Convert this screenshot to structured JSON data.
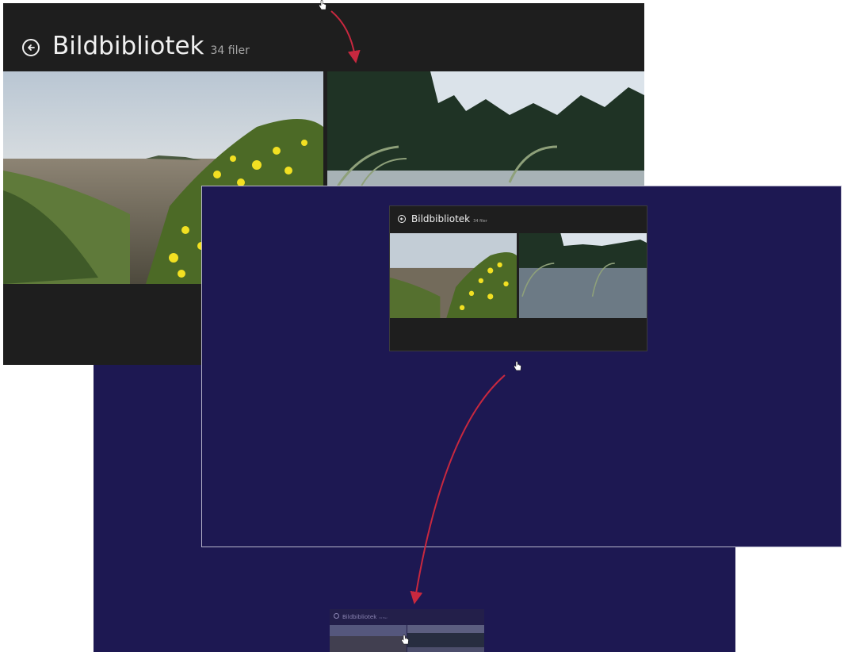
{
  "colors": {
    "start_screen": "#1d1852",
    "app_background": "#1e1e1e",
    "title_text": "#f0f0f0",
    "count_text": "#a8a8a8",
    "arrow": "#c8283f"
  },
  "app": {
    "title": "Bildbibliotek",
    "file_count": "34 filer",
    "back_icon": "back-arrow-circle-icon",
    "photos": [
      "meadow-with-yellow-flowers",
      "forest-river"
    ]
  },
  "gesture": {
    "cursor_icon": "hand-cursor-icon",
    "arrow_icon": "curved-arrow-icon"
  }
}
